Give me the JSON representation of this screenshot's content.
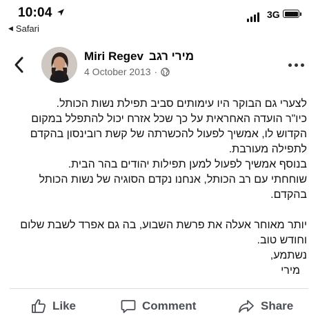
{
  "status_bar": {
    "time": "10:04",
    "back_app": "Safari",
    "network": "3G"
  },
  "post": {
    "author_en": "Miri Regev",
    "author_he": "מירי רגב",
    "date": "4 October 2013",
    "separator": "·",
    "body_lines": [
      "לצערי גם הבוקר היו עימותים סביב תפילת נשות הכותל.",
      "כיו\"ר הועדה האחראית על כך שכל אזרח יכול להתפלל במקום",
      "הקדוש לו, אמשיך לפעול להכשרתה של קשת רובינסון בהקדם",
      "לתפילה מעורבת.",
      "בנוסף אמשיך לפעול למען תפילות יהודים בהר הבית.",
      "שוחחתי עם רב הכותל, אנחנו נקדם הסוגיה של נשות הכותל",
      "בהקדם.",
      "",
      "יותר מאוחר אעלה את פרשת השבוע, בה גם אפרד לשבת שלום",
      "וחודש טוב.",
      "נשתמע,",
      "מירי"
    ]
  },
  "actions": {
    "like": "Like",
    "comment": "Comment",
    "share": "Share"
  },
  "icons": {
    "location": "location-arrow-icon",
    "back": "chevron-left-icon",
    "privacy": "globe-icon",
    "more": "more-dots-icon",
    "like": "thumbs-up-icon",
    "comment": "comment-bubble-icon",
    "share": "share-arrow-icon"
  }
}
